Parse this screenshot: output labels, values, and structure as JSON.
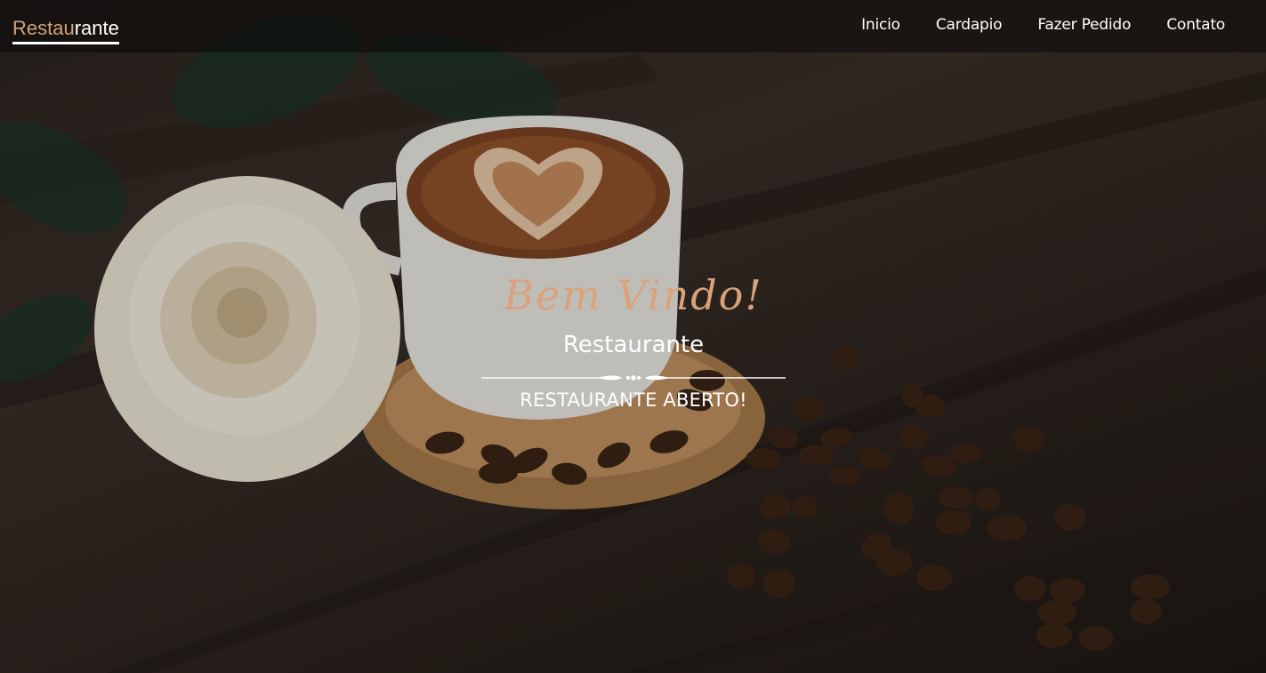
{
  "brand": {
    "part1": "Restau",
    "part2": "rante",
    "accent_color": "#d4a27a"
  },
  "nav": {
    "items": [
      {
        "label": "Inicio"
      },
      {
        "label": "Cardapio"
      },
      {
        "label": "Fazer Pedido"
      },
      {
        "label": "Contato"
      }
    ]
  },
  "hero": {
    "welcome": "Bem Vindo!",
    "subtitle": "Restaurante",
    "status": "RESTAURANTE ABERTO!",
    "welcome_color": "#d9a27a",
    "background_image": "coffee-cup-rose-beans-on-wood"
  }
}
